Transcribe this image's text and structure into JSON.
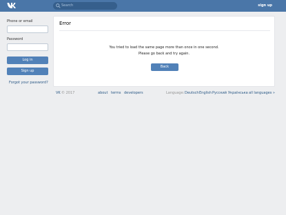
{
  "header": {
    "search_placeholder": "Search",
    "signup": "sign up",
    "icons": {
      "logo": "vk-logo",
      "search": "search-icon"
    },
    "colors": {
      "bar": "#4a76a8",
      "accent": "#5181b8"
    }
  },
  "login": {
    "phone_label": "Phone or email",
    "password_label": "Password",
    "login_button": "Log in",
    "signup_button": "Sign up",
    "forgot": "Forgot your password?"
  },
  "error": {
    "title": "Error",
    "line1": "You tried to load the same page more than once in one second.",
    "line2": "Please go back and try again.",
    "back_button": "Back"
  },
  "footer": {
    "brand": "VK",
    "year": "© 2017",
    "links": [
      "about",
      "terms",
      "developers"
    ],
    "language_label": "Language:",
    "languages": [
      "Deutsch",
      "English",
      "Русский",
      "Українська",
      "all languages »"
    ]
  }
}
